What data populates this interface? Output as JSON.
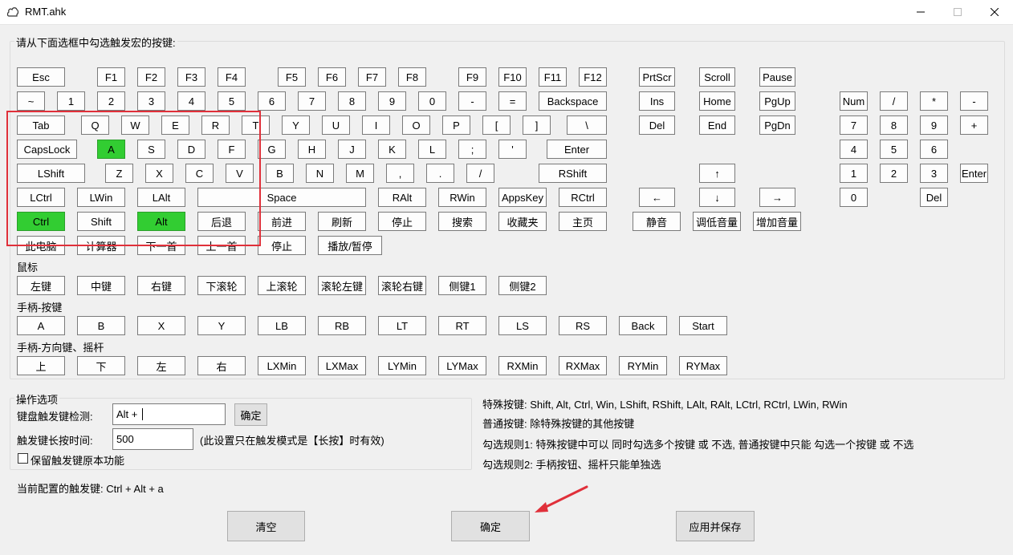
{
  "window": {
    "title": "RMT.ahk"
  },
  "keyboard": {
    "group_label": "请从下面选框中勾选触发宏的按键:",
    "keys": {
      "esc": "Esc",
      "f1": "F1",
      "f2": "F2",
      "f3": "F3",
      "f4": "F4",
      "f5": "F5",
      "f6": "F6",
      "f7": "F7",
      "f8": "F8",
      "f9": "F9",
      "f10": "F10",
      "f11": "F11",
      "f12": "F12",
      "prtscr": "PrtScr",
      "scroll": "Scroll",
      "pause": "Pause",
      "tilde": "~",
      "d1": "1",
      "d2": "2",
      "d3": "3",
      "d4": "4",
      "d5": "5",
      "d6": "6",
      "d7": "7",
      "d8": "8",
      "d9": "9",
      "d0": "0",
      "minus": "-",
      "equal": "=",
      "backspace": "Backspace",
      "ins": "Ins",
      "home": "Home",
      "pgup": "PgUp",
      "num": "Num",
      "np_div": "/",
      "np_mul": "*",
      "np_sub": "-",
      "tab": "Tab",
      "q": "Q",
      "w": "W",
      "e": "E",
      "r": "R",
      "t": "T",
      "y": "Y",
      "u": "U",
      "i": "I",
      "o": "O",
      "p": "P",
      "lbracket": "[",
      "rbracket": "]",
      "backslash": "\\",
      "del": "Del",
      "end": "End",
      "pgdn": "PgDn",
      "np7": "7",
      "np8": "8",
      "np9": "9",
      "np_add": "+",
      "capslock": "CapsLock",
      "a": "A",
      "s": "S",
      "d": "D",
      "f": "F",
      "g": "G",
      "h": "H",
      "j": "J",
      "k": "K",
      "l": "L",
      "semicolon": ";",
      "quote": "'",
      "enter": "Enter",
      "np4": "4",
      "np5": "5",
      "np6": "6",
      "lshift": "LShift",
      "z": "Z",
      "x": "X",
      "c": "C",
      "v": "V",
      "b": "B",
      "n": "N",
      "m": "M",
      "comma": ",",
      "period": ".",
      "slash": "/",
      "rshift": "RShift",
      "up": "↑",
      "np1": "1",
      "np2": "2",
      "np3": "3",
      "np_enter": "Enter",
      "lctrl": "LCtrl",
      "lwin": "LWin",
      "lalt": "LAlt",
      "space": "Space",
      "ralt": "RAlt",
      "rwin": "RWin",
      "appskey": "AppsKey",
      "rctrl": "RCtrl",
      "left": "←",
      "down": "↓",
      "right": "→",
      "np0": "0",
      "np_del": "Del",
      "ctrl": "Ctrl",
      "shift": "Shift",
      "alt": "Alt",
      "back": "后退",
      "forward": "前进",
      "refresh": "刷新",
      "stop": "停止",
      "search": "搜索",
      "favorites": "收藏夹",
      "homepage": "主页",
      "mute": "静音",
      "vol_down": "调低音量",
      "vol_up": "增加音量",
      "computer": "此电脑",
      "calculator": "计算器",
      "next_track": "下一首",
      "prev_track": "上一首",
      "media_stop": "停止",
      "play_pause": "播放/暂停"
    },
    "checked": [
      "a",
      "ctrl",
      "alt"
    ]
  },
  "mouse": {
    "label": "鼠标",
    "keys": [
      "左键",
      "中键",
      "右键",
      "下滚轮",
      "上滚轮",
      "滚轮左键",
      "滚轮右键",
      "侧键1",
      "侧键2"
    ]
  },
  "gamepad_buttons": {
    "label": "手柄-按键",
    "keys": [
      "A",
      "B",
      "X",
      "Y",
      "LB",
      "RB",
      "LT",
      "RT",
      "LS",
      "RS",
      "Back",
      "Start"
    ]
  },
  "gamepad_axes": {
    "label": "手柄-方向键、摇杆",
    "keys": [
      "上",
      "下",
      "左",
      "右",
      "LXMin",
      "LXMax",
      "LYMin",
      "LYMax",
      "RXMin",
      "RXMax",
      "RYMin",
      "RYMax"
    ]
  },
  "options": {
    "group_label": "操作选项",
    "detect_label": "键盘触发键检测:",
    "detect_value": "Alt + ",
    "confirm_small": "确定",
    "hold_label": "触发键长按时间:",
    "hold_value": "500",
    "hold_note": "(此设置只在触发模式是【长按】时有效)",
    "keep_original_label": "保留触发键原本功能",
    "keep_original_checked": false
  },
  "rules": {
    "line1": "特殊按键: Shift, Alt, Ctrl, Win, LShift, RShift, LAlt, RAlt, LCtrl, RCtrl, LWin, RWin",
    "line2": "普通按键: 除特殊按键的其他按键",
    "line3": "勾选规则1: 特殊按键中可以 同时勾选多个按键 或 不选, 普通按键中只能 勾选一个按键 或 不选",
    "line4": "勾选规则2: 手柄按钮、摇杆只能单独选"
  },
  "current": {
    "text": "当前配置的触发键: Ctrl + Alt + a"
  },
  "footer": {
    "clear": "清空",
    "confirm": "确定",
    "apply_save": "应用并保存"
  }
}
